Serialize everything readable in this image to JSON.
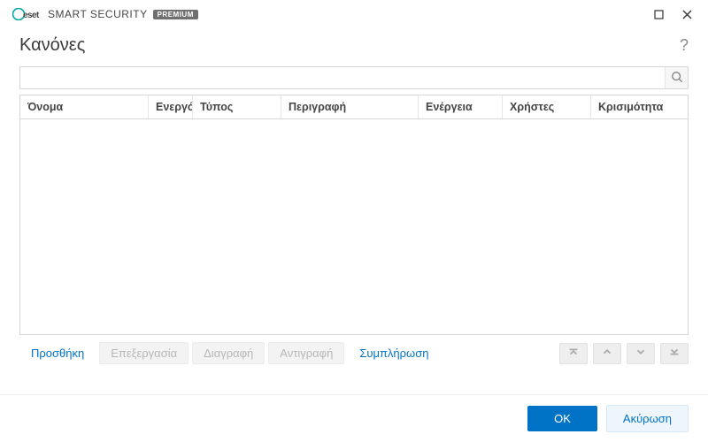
{
  "titlebar": {
    "brand_name": "SMART SECURITY",
    "brand_badge": "PREMIUM"
  },
  "header": {
    "title": "Κανόνες"
  },
  "search": {
    "value": "",
    "placeholder": ""
  },
  "table": {
    "columns": {
      "name": "Όνομα",
      "active": "Ενεργό",
      "type": "Τύπος",
      "desc": "Περιγραφή",
      "action": "Ενέργεια",
      "users": "Χρήστες",
      "severity": "Κρισιμότητα"
    },
    "rows": []
  },
  "actions": {
    "add": "Προσθήκη",
    "edit": "Επεξεργασία",
    "delete": "Διαγραφή",
    "copy": "Αντιγραφή",
    "populate": "Συμπλήρωση"
  },
  "footer": {
    "ok": "OK",
    "cancel": "Ακύρωση"
  }
}
